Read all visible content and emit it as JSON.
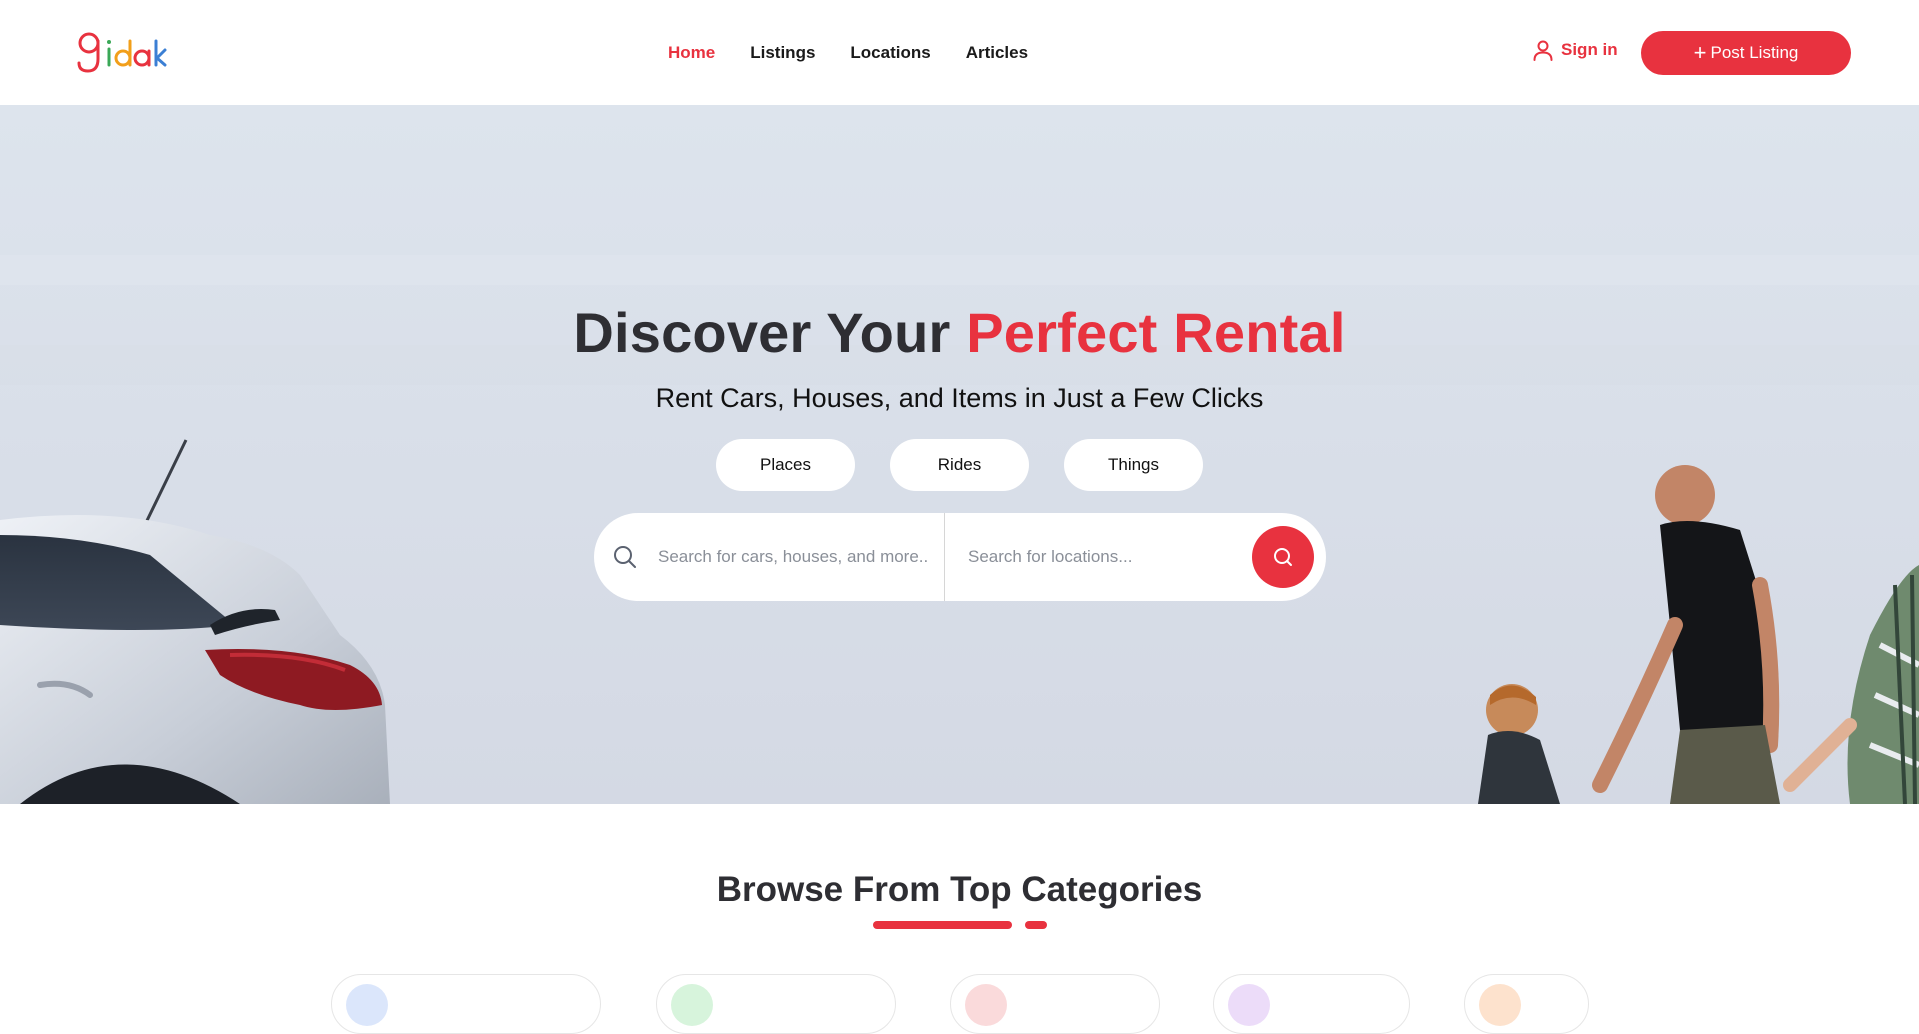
{
  "header": {
    "logo_text": "gidak",
    "nav": [
      {
        "label": "Home",
        "active": true
      },
      {
        "label": "Listings",
        "active": false
      },
      {
        "label": "Locations",
        "active": false
      },
      {
        "label": "Articles",
        "active": false
      }
    ],
    "sign_in_label": "Sign in",
    "post_listing_label": "Post Listing"
  },
  "hero": {
    "title_prefix": "Discover Your",
    "title_accent": "Perfect Rental",
    "subtitle": "Rent Cars, Houses, and Items in Just a Few Clicks",
    "tabs": [
      {
        "label": "Places"
      },
      {
        "label": "Rides"
      },
      {
        "label": "Things"
      }
    ],
    "search": {
      "query_placeholder": "Search for cars, houses, and more...",
      "location_placeholder": "Search for locations...",
      "query_value": "",
      "location_value": ""
    }
  },
  "categories": {
    "title": "Browse From Top Categories"
  },
  "colors": {
    "accent": "#e8323f",
    "text_dark": "#2e2e33",
    "logo_g": "#e8323f",
    "logo_i": "#3aa857",
    "logo_d": "#f29f1a",
    "logo_a": "#e8323f",
    "logo_k": "#3b7fd4",
    "category_dots": [
      "#dbe6fb",
      "#d7f4dc",
      "#fadadb",
      "#ecdcf9",
      "#fde2cd"
    ]
  },
  "icons": {
    "user": "user-icon",
    "plus": "plus-icon",
    "search": "search-icon"
  }
}
